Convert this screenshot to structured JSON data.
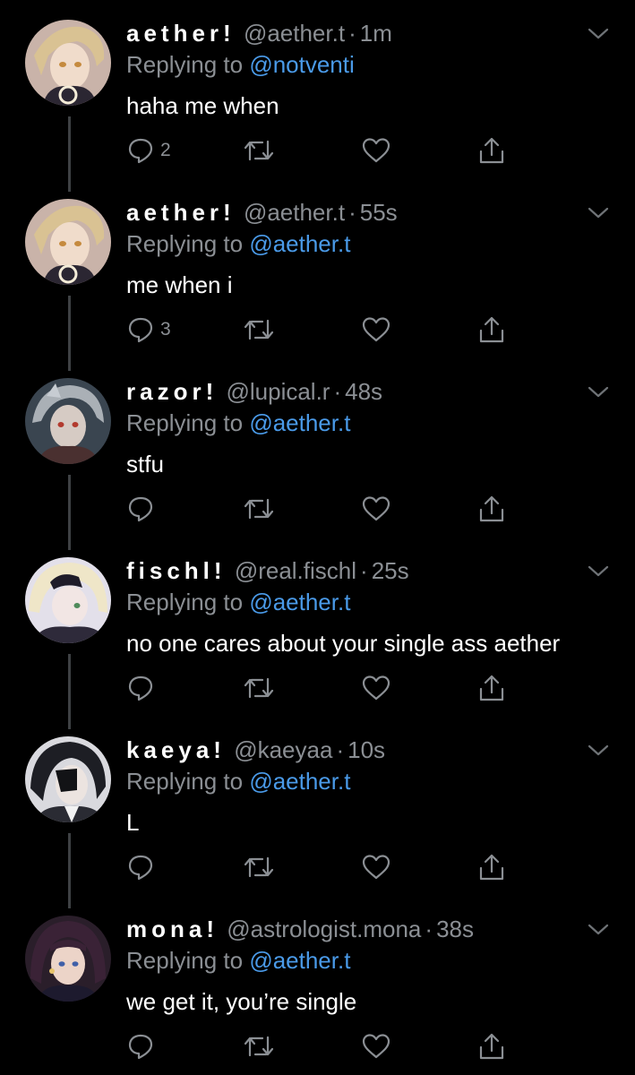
{
  "icons": {
    "reply": "reply-icon",
    "retweet": "retweet-icon",
    "like": "heart-icon",
    "share": "share-icon",
    "more": "chevron-down-icon"
  },
  "colors": {
    "background": "#000000",
    "text": "#ffffff",
    "muted": "#8b8f94",
    "mention": "#4a9ae8",
    "thread_line": "#3e4144"
  },
  "replying_prefix": "Replying to",
  "tweets": [
    {
      "display_name": "aether!",
      "handle": "@aether.t",
      "time": "1m",
      "replying_to": "@notventi",
      "text": "haha me when",
      "reply_count": "2"
    },
    {
      "display_name": "aether!",
      "handle": "@aether.t",
      "time": "55s",
      "replying_to": "@aether.t",
      "text": "me when i",
      "reply_count": "3"
    },
    {
      "display_name": "razor!",
      "handle": "@lupical.r",
      "time": "48s",
      "replying_to": "@aether.t",
      "text": "stfu",
      "reply_count": ""
    },
    {
      "display_name": "fischl!",
      "handle": "@real.fischl",
      "time": "25s",
      "replying_to": "@aether.t",
      "text": "no one cares about your single ass aether",
      "reply_count": ""
    },
    {
      "display_name": "kaeya!",
      "handle": "@kaeyaa",
      "time": "10s",
      "replying_to": "@aether.t",
      "text": "L",
      "reply_count": ""
    },
    {
      "display_name": "mona!",
      "handle": "@astrologist.mona",
      "time": "38s",
      "replying_to": "@aether.t",
      "text": "we get it, you’re single",
      "reply_count": ""
    }
  ]
}
